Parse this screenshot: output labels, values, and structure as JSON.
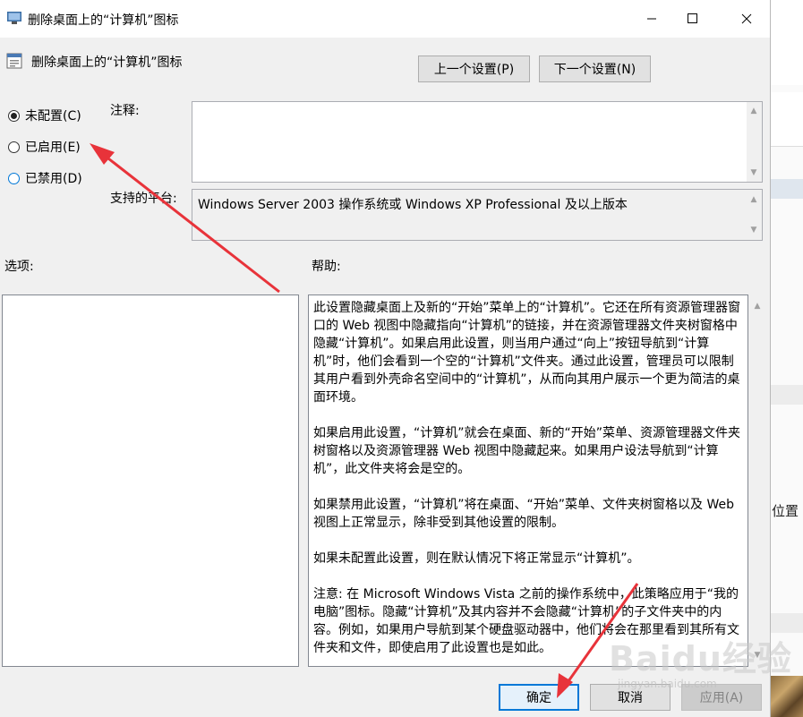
{
  "window": {
    "title": "删除桌面上的“计算机”图标"
  },
  "policy": {
    "name": "删除桌面上的“计算机”图标"
  },
  "nav": {
    "prev_label": "上一个设置(P)",
    "next_label": "下一个设置(N)"
  },
  "state": {
    "options": [
      {
        "label": "未配置(C)",
        "checked": true
      },
      {
        "label": "已启用(E)",
        "checked": false
      },
      {
        "label": "已禁用(D)",
        "checked": false
      }
    ]
  },
  "comment": {
    "label": "注释:",
    "value": ""
  },
  "platform": {
    "label": "支持的平台:",
    "value": "Windows Server 2003 操作系统或 Windows XP Professional 及以上版本"
  },
  "options_panel": {
    "label": "选项:"
  },
  "help": {
    "label": "帮助:",
    "paragraphs": [
      "此设置隐藏桌面上及新的“开始”菜单上的“计算机”。它还在所有资源管理器窗口的 Web 视图中隐藏指向“计算机”的链接，并在资源管理器文件夹树窗格中隐藏“计算机”。如果启用此设置，则当用户通过“向上”按钮导航到“计算机”时，他们会看到一个空的“计算机”文件夹。通过此设置，管理员可以限制其用户看到外壳命名空间中的“计算机”，从而向其用户展示一个更为简洁的桌面环境。",
      "如果启用此设置，“计算机”就会在桌面、新的“开始”菜单、资源管理器文件夹树窗格以及资源管理器 Web 视图中隐藏起来。如果用户设法导航到“计算机”，此文件夹将会是空的。",
      "如果禁用此设置，“计算机”将在桌面、“开始”菜单、文件夹树窗格以及 Web 视图上正常显示，除非受到其他设置的限制。",
      "如果未配置此设置，则在默认情况下将正常显示“计算机”。",
      "注意: 在 Microsoft Windows Vista 之前的操作系统中，此策略应用于“我的电脑”图标。隐藏“计算机”及其内容并不会隐藏“计算机”的子文件夹中的内容。例如，如果用户导航到某个硬盘驱动器中，他们将会在那里看到其所有文件夹和文件，即使启用了此设置也是如此。"
    ]
  },
  "footer": {
    "ok_label": "确定",
    "cancel_label": "取消",
    "apply_label": "应用(A)"
  },
  "background": {
    "partial_text": "位置"
  },
  "watermark": {
    "brand": "Baidu经验",
    "url": "jingyan.baidu.com"
  },
  "colors": {
    "accent": "#0078d7",
    "arrow": "#e8333a"
  }
}
